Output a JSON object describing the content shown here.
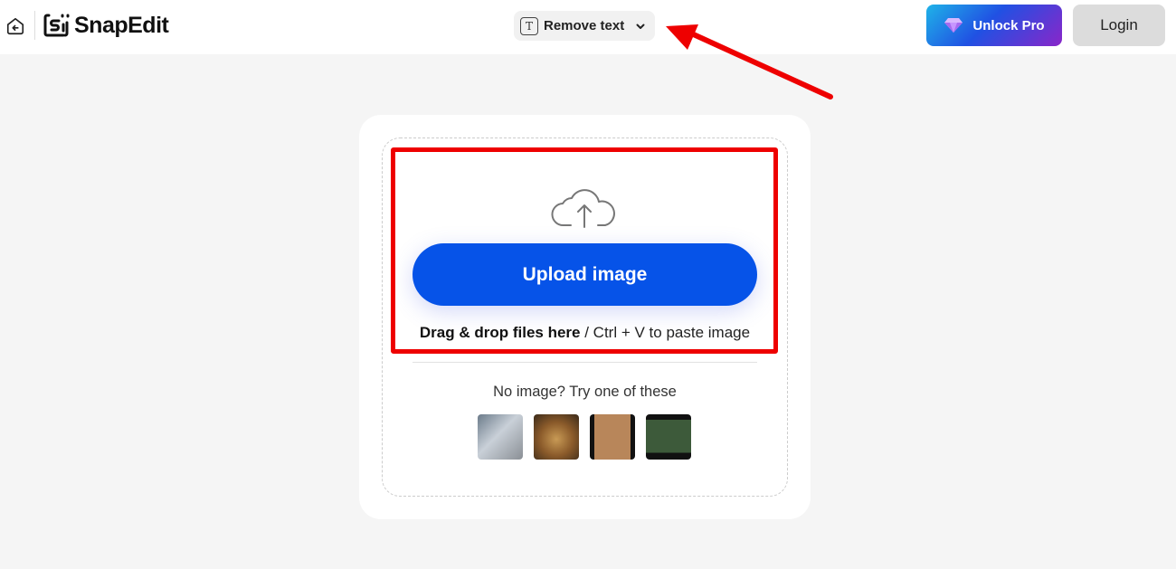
{
  "header": {
    "back_icon": "home-back-icon",
    "logo_icon": "snapedit-logo-icon",
    "logo_text": "SnapEdit",
    "tool_selector": {
      "icon": "text-t-icon",
      "label": "Remove text",
      "chevron": "chevron-down-icon"
    },
    "unlock_pro": {
      "icon": "diamond-icon",
      "label": "Unlock Pro"
    },
    "login_label": "Login"
  },
  "upload": {
    "icon": "cloud-upload-icon",
    "button_label": "Upload image",
    "drag_bold": "Drag & drop files here",
    "drag_rest": " / Ctrl + V to paste image",
    "try_text": "No image? Try one of these",
    "samples": [
      {
        "name": "sample-book"
      },
      {
        "name": "sample-cat-box"
      },
      {
        "name": "sample-person-sign"
      },
      {
        "name": "sample-street-sign"
      }
    ]
  },
  "annotations": {
    "color": "#ee0000"
  }
}
